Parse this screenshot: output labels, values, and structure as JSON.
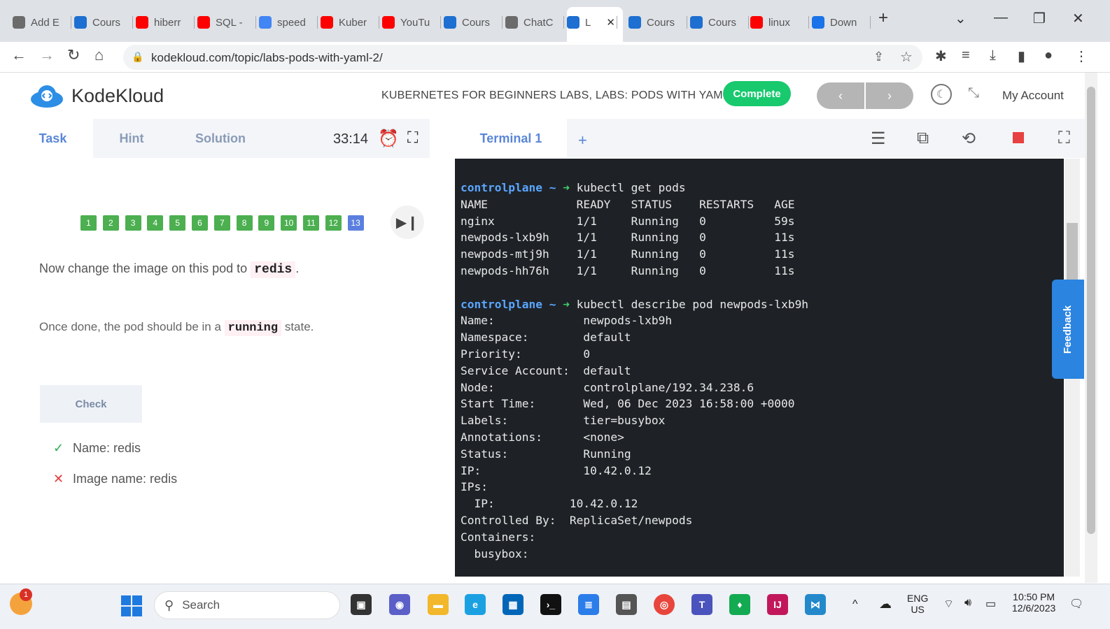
{
  "browser": {
    "tabs": [
      {
        "label": "Add E",
        "icon": "chatgpt-icon",
        "color": "#6b6b6b"
      },
      {
        "label": "Cours",
        "icon": "kodekloud-icon",
        "color": "#1d6fd1"
      },
      {
        "label": "hiberr",
        "icon": "youtube-icon",
        "color": "#ff0000"
      },
      {
        "label": "SQL -",
        "icon": "youtube-icon",
        "color": "#ff0000"
      },
      {
        "label": "speed",
        "icon": "google-icon",
        "color": "#4285f4"
      },
      {
        "label": "Kuber",
        "icon": "youtube-icon",
        "color": "#ff0000"
      },
      {
        "label": "YouTu",
        "icon": "youtube-icon",
        "color": "#ff0000"
      },
      {
        "label": "Cours",
        "icon": "kodekloud-icon",
        "color": "#1d6fd1"
      },
      {
        "label": "ChatC",
        "icon": "chatgpt-icon",
        "color": "#6b6b6b"
      },
      {
        "label": "L",
        "icon": "kodekloud-icon",
        "color": "#1d6fd1"
      },
      {
        "label": "Cours",
        "icon": "kodekloud-icon",
        "color": "#1d6fd1"
      },
      {
        "label": "Cours",
        "icon": "kodekloud-icon",
        "color": "#1d6fd1"
      },
      {
        "label": "linux",
        "icon": "youtube-icon",
        "color": "#ff0000"
      },
      {
        "label": "Down",
        "icon": "download-icon",
        "color": "#1a73e8"
      }
    ],
    "url": "kodekloud.com/topic/labs-pods-with-yaml-2/"
  },
  "header": {
    "logo_text": "KodeKloud",
    "course_title": "KUBERNETES FOR BEGINNERS LABS, LABS: PODS WITH YAML",
    "complete_label": "Complete",
    "prev_label": "‹",
    "next_label": "›",
    "account_label": "My Account",
    "accent": "#18c96e"
  },
  "task_panel": {
    "tabs": [
      "Task",
      "Hint",
      "Solution"
    ],
    "timer": "33:14",
    "questions": [
      "1",
      "2",
      "3",
      "4",
      "5",
      "6",
      "7",
      "8",
      "9",
      "10",
      "11",
      "12",
      "13"
    ],
    "current_question": "13",
    "instruction_pre": "Now change the image on this pod to",
    "instruction_code": "redis",
    "instruction_post": ".",
    "state_pre": "Once done, the pod should be in a",
    "state_code": "running",
    "state_post": "state.",
    "check_label": "Check",
    "checks": [
      {
        "mark": "✓",
        "label": "Name: redis",
        "passed": true
      },
      {
        "mark": "✕",
        "label": "Image name: redis",
        "passed": false
      }
    ]
  },
  "terminal": {
    "tab_label": "Terminal 1",
    "add_label": "+",
    "prompt_host": "controlplane ~",
    "cmd1": "kubectl get pods",
    "pods_header": "NAME             READY   STATUS    RESTARTS   AGE",
    "pods": [
      "nginx            1/1     Running   0          59s",
      "newpods-lxb9h    1/1     Running   0          11s",
      "newpods-mtj9h    1/1     Running   0          11s",
      "newpods-hh76h    1/1     Running   0          11s"
    ],
    "cmd2": "kubectl describe pod newpods-lxb9h",
    "describe": [
      "Name:             newpods-lxb9h",
      "Namespace:        default",
      "Priority:         0",
      "Service Account:  default",
      "Node:             controlplane/192.34.238.6",
      "Start Time:       Wed, 06 Dec 2023 16:58:00 +0000",
      "Labels:           tier=busybox",
      "Annotations:      <none>",
      "Status:           Running",
      "IP:               10.42.0.12",
      "IPs:",
      "  IP:           10.42.0.12",
      "Controlled By:  ReplicaSet/newpods",
      "Containers:",
      "  busybox:"
    ]
  },
  "feedback_label": "Feedback",
  "taskbar": {
    "search_placeholder": "Search",
    "lang_top": "ENG",
    "lang_bottom": "US",
    "time": "10:50 PM",
    "date": "12/6/2023",
    "notification_count": "1"
  }
}
